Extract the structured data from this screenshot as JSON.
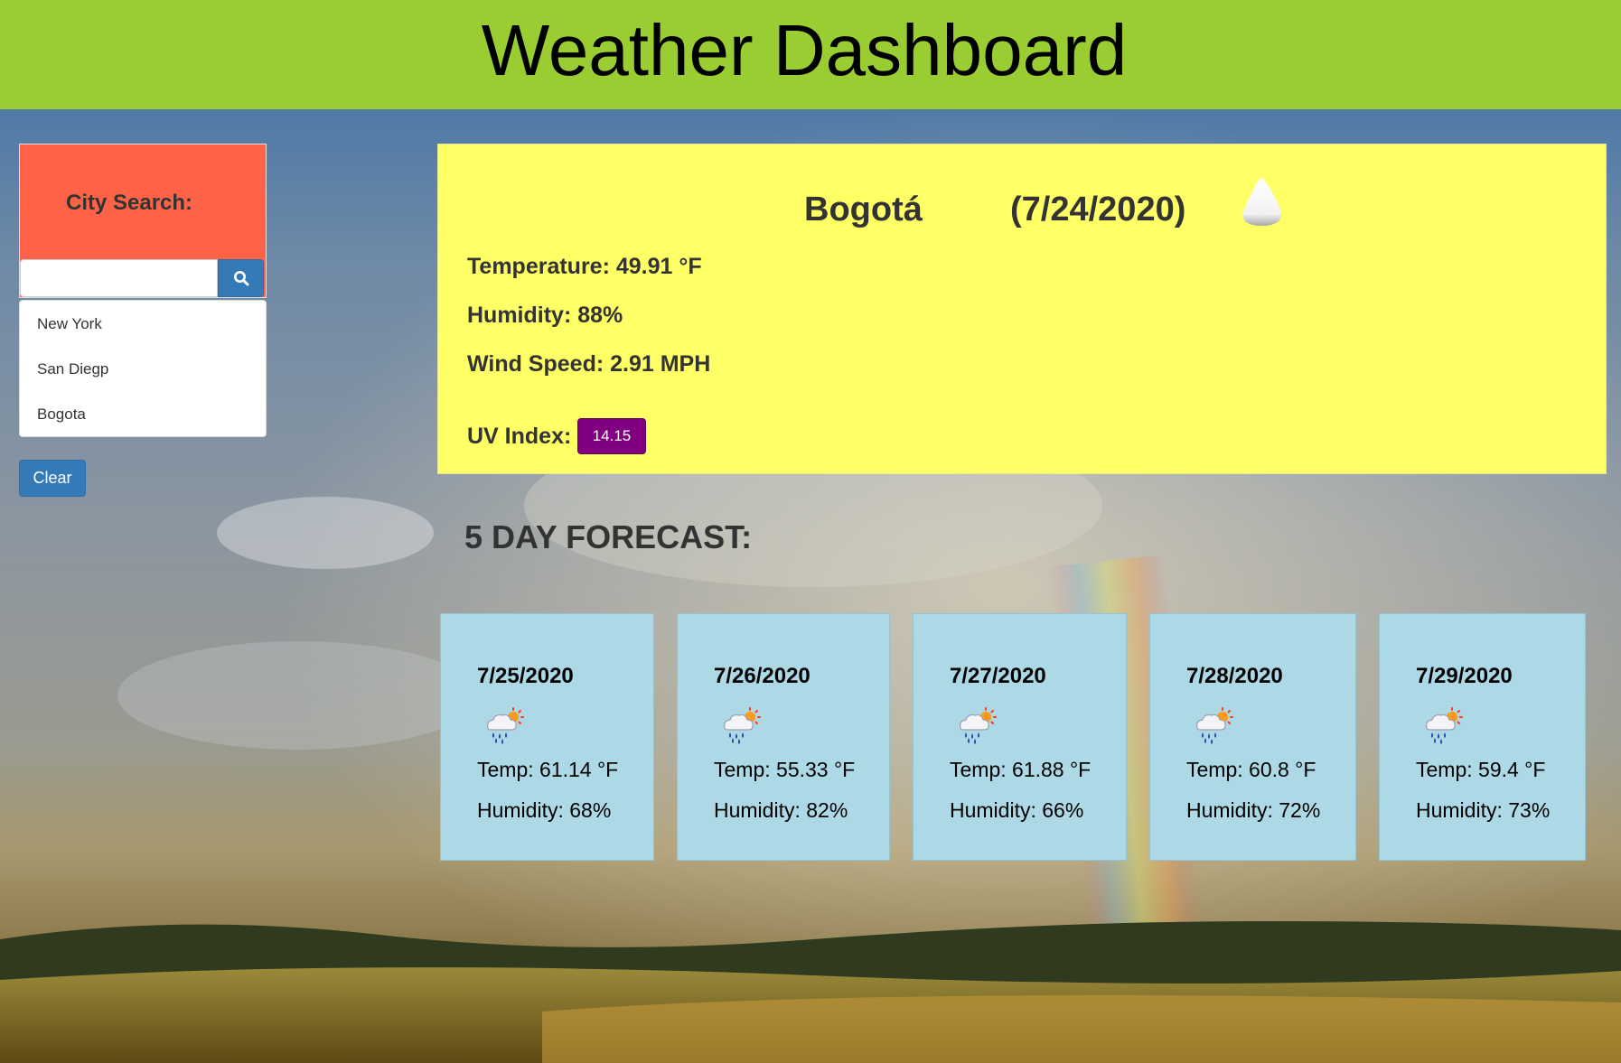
{
  "header": {
    "title": "Weather Dashboard"
  },
  "sidebar": {
    "search_label": "City Search:",
    "search_value": "",
    "search_placeholder": "",
    "history": [
      "New York",
      "San Diegp",
      "Bogota"
    ],
    "clear_label": "Clear"
  },
  "current": {
    "city": "Bogotá",
    "date": "(7/24/2020)",
    "icon": "cloud-icon",
    "temperature": "Temperature: 49.91 °F",
    "humidity": "Humidity: 88%",
    "wind": "Wind Speed: 2.91 MPH",
    "uv_label": "UV Index:",
    "uv_value": "14.15",
    "uv_color": "#800080"
  },
  "forecast": {
    "title": "5 DAY FORECAST:",
    "days": [
      {
        "date": "7/25/2020",
        "icon": "rain-sun-icon",
        "temp": "Temp: 61.14 °F",
        "humidity": "Humidity: 68%"
      },
      {
        "date": "7/26/2020",
        "icon": "rain-sun-icon",
        "temp": "Temp: 55.33 °F",
        "humidity": "Humidity: 82%"
      },
      {
        "date": "7/27/2020",
        "icon": "rain-sun-icon",
        "temp": "Temp: 61.88 °F",
        "humidity": "Humidity: 66%"
      },
      {
        "date": "7/28/2020",
        "icon": "rain-sun-icon",
        "temp": "Temp: 60.8 °F",
        "humidity": "Humidity: 72%"
      },
      {
        "date": "7/29/2020",
        "icon": "rain-sun-icon",
        "temp": "Temp: 59.4 °F",
        "humidity": "Humidity: 73%"
      }
    ]
  },
  "colors": {
    "header": "#9acd32",
    "city_panel": "#ff6347",
    "current_panel": "#ffff66",
    "forecast_card": "#add8e6",
    "button": "#337ab7"
  }
}
